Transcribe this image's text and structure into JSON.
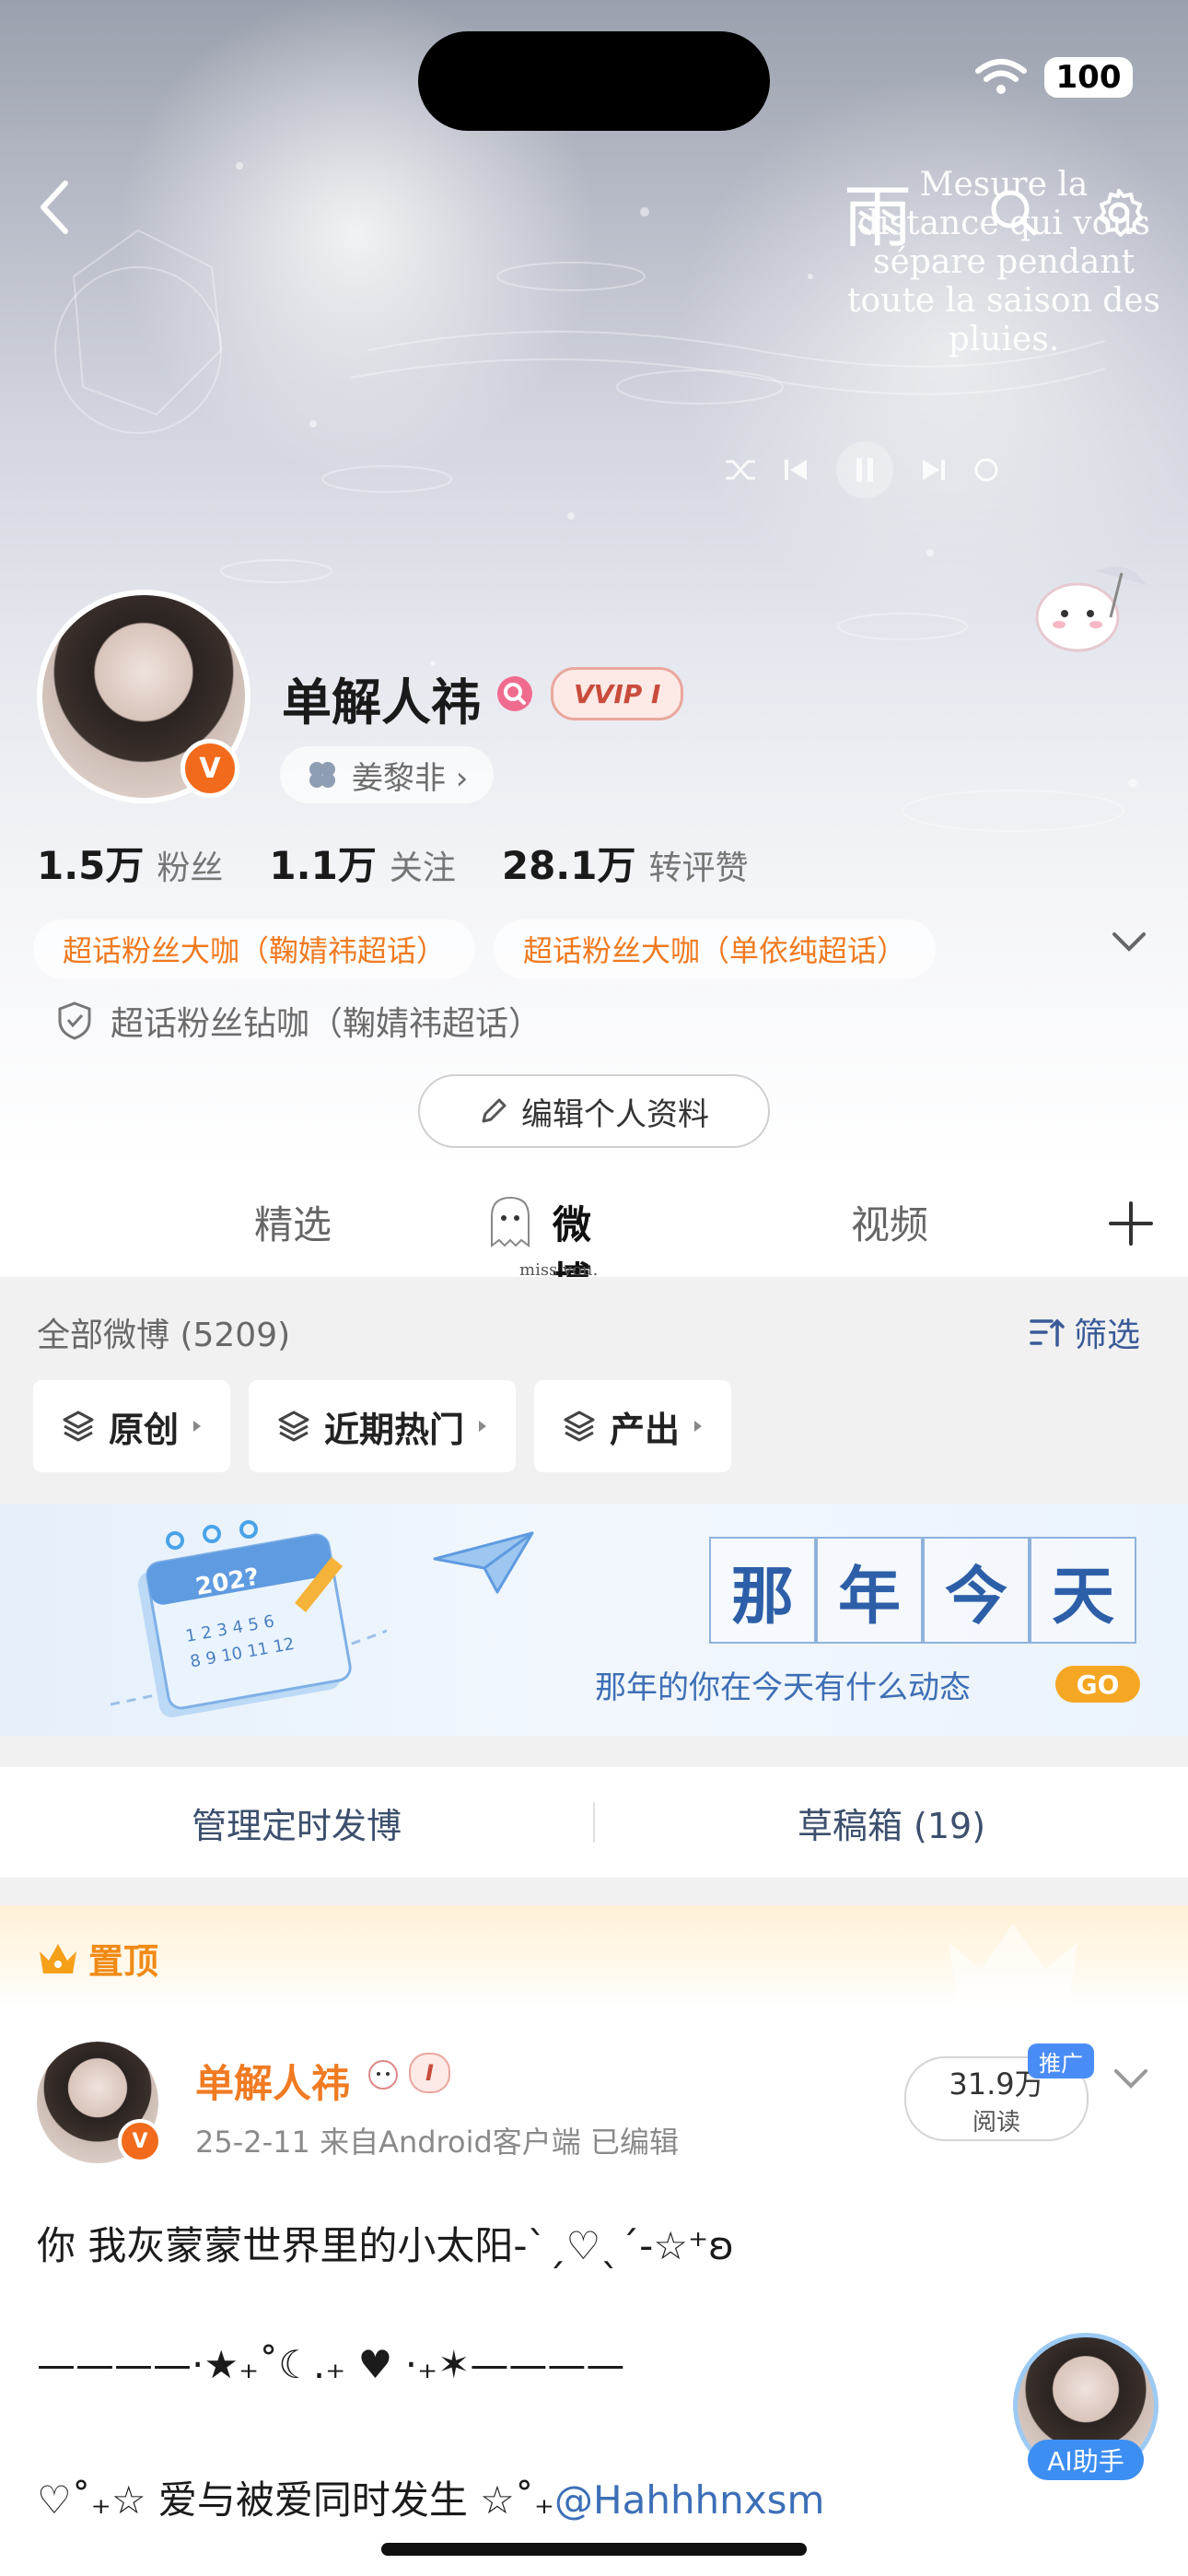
{
  "status": {
    "battery": "100"
  },
  "header": {
    "overlay_glyph": "雨",
    "overlay_text_lines": [
      "Mesure la",
      "distance qui vous",
      "sépare pendant",
      "toute la saison des",
      "pluies."
    ]
  },
  "profile": {
    "name": "单解人祎",
    "vip_label": "VVIP I",
    "tag_chip": "姜黎非 ›",
    "verified_badge": "V",
    "stats": [
      {
        "num": "1.5万",
        "label": "粉丝"
      },
      {
        "num": "1.1万",
        "label": "关注"
      },
      {
        "num": "28.1万",
        "label": "转评赞"
      }
    ],
    "fan_tags": [
      "超话粉丝大咖（鞠婧祎超话）",
      "超话粉丝大咖（单依纯超话）"
    ],
    "diamond_tag": "超话粉丝钻咖（鞠婧祎超话）",
    "edit_button": "编辑个人资料"
  },
  "tabs": {
    "items": [
      "精选",
      "微博",
      "视频"
    ],
    "active": "微博",
    "active_caption": "miss you."
  },
  "feed": {
    "all_weibo": "全部微博 (5209)",
    "filter": "筛选",
    "chips": [
      "原创",
      "近期热门",
      "产出"
    ]
  },
  "banner": {
    "title_chars": [
      "那",
      "年",
      "今",
      "天"
    ],
    "subtitle": "那年的你在今天有什么动态",
    "go": "GO",
    "calendar_year": "202?"
  },
  "manage": {
    "scheduled": "管理定时发博",
    "drafts": "草稿箱 (19)"
  },
  "post": {
    "pinned_label": "置顶",
    "author": "单解人祎",
    "author_badge": "I",
    "meta": "25-2-11  来自Android客户端  已编辑",
    "reads_num": "31.9万",
    "reads_label": "阅读",
    "promo": "推广",
    "lines": [
      "你 我灰蒙蒙世界里的小太阳-ˋˏ♡ˎˊ-☆⁺ʚ",
      "————·★₊˚☾.₊ ♥ ·₊✶————",
      "♡˚₊☆ 爱与被爱同时发生   ☆˚₊"
    ],
    "mention": "@Hahhhnxsm"
  },
  "ai_assistant": {
    "label": "AI助手"
  },
  "colors": {
    "accent_orange": "#f07b22",
    "link_blue": "#3c6fb7",
    "battery_bg": "#ffffff"
  }
}
